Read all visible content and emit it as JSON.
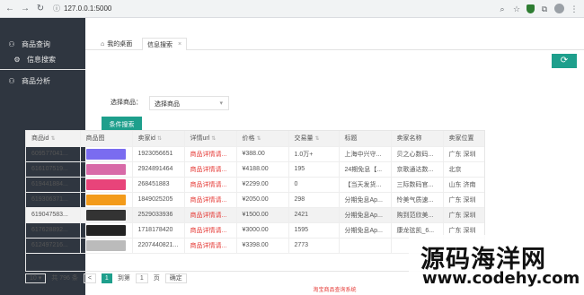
{
  "browser": {
    "url": "127.0.0.1:5000"
  },
  "sidebar": {
    "items": [
      {
        "label": "商品查询",
        "icon": "user-icon"
      },
      {
        "label": "信息搜索",
        "icon": "gear-icon"
      },
      {
        "label": "商品分析",
        "icon": "user-icon"
      }
    ]
  },
  "tabs": [
    {
      "label": "我的桌面",
      "icon": "home-icon"
    },
    {
      "label": "信息搜索",
      "close": "×"
    }
  ],
  "filter": {
    "label": "选择商品：",
    "value": "选择商品",
    "button": "条件搜索"
  },
  "table": {
    "columns": [
      "商品id",
      "商品图",
      "卖家id",
      "详情url",
      "价格",
      "交易量",
      "标题",
      "卖家名称",
      "卖家位置"
    ],
    "rows": [
      {
        "id": "609577041...",
        "seller_id": "1923056651",
        "url": "商品详情请...",
        "price": "¥388.00",
        "volume": "1.0万+",
        "title": "上海中兴守...",
        "seller": "贝之心数码...",
        "loc": "广东 深圳",
        "thumb": "#7a6cf0"
      },
      {
        "id": "616107519...",
        "seller_id": "2924891464",
        "url": "商品详情请...",
        "price": "¥4188.00",
        "volume": "195",
        "title": "24期免息【...",
        "seller": "京歌通达数...",
        "loc": "北京",
        "thumb": "#d86aa8"
      },
      {
        "id": "619441884...",
        "seller_id": "268451883",
        "url": "商品详情请...",
        "price": "¥2299.00",
        "volume": "0",
        "title": "【当天发货...",
        "seller": "三际数码官...",
        "loc": "山东 济南",
        "thumb": "#e8447a"
      },
      {
        "id": "619306371...",
        "seller_id": "1849025205",
        "url": "商品详情请...",
        "price": "¥2050.00",
        "volume": "298",
        "title": "分期免息Ap...",
        "seller": "怜美气质速...",
        "loc": "广东 深圳",
        "thumb": "#f39b1b"
      },
      {
        "id": "619047583...",
        "seller_id": "2529033936",
        "url": "商品详情请...",
        "price": "¥1500.00",
        "volume": "2421",
        "title": "分期免息Ap...",
        "seller": "购到范欣美...",
        "loc": "广东 深圳",
        "thumb": "#333333"
      },
      {
        "id": "617628892...",
        "seller_id": "1718178420",
        "url": "商品详情请...",
        "price": "¥3000.00",
        "volume": "1595",
        "title": "分期免息Ap...",
        "seller": "康龙弦凯_6...",
        "loc": "广东 深圳",
        "thumb": "#222222"
      },
      {
        "id": "612497216...",
        "seller_id": "2207440821...",
        "url": "商品详情请...",
        "price": "¥3398.00",
        "volume": "2773",
        "title": "",
        "seller": "",
        "loc": "",
        "thumb": "#bbbbbb"
      }
    ]
  },
  "pager": {
    "nav": "<",
    "summary": "共 796 条",
    "current": "1",
    "goto": "到第",
    "page_input": "1",
    "page_unit": "页",
    "confirm": "确定"
  },
  "footer": "淘宝商品查询系统",
  "watermark": {
    "line1": "源码海洋网",
    "line2": "www.codehy.com"
  },
  "colors": {
    "accent": "#1e9f8c",
    "sidebar": "#2f3640",
    "link": "#e53935"
  }
}
